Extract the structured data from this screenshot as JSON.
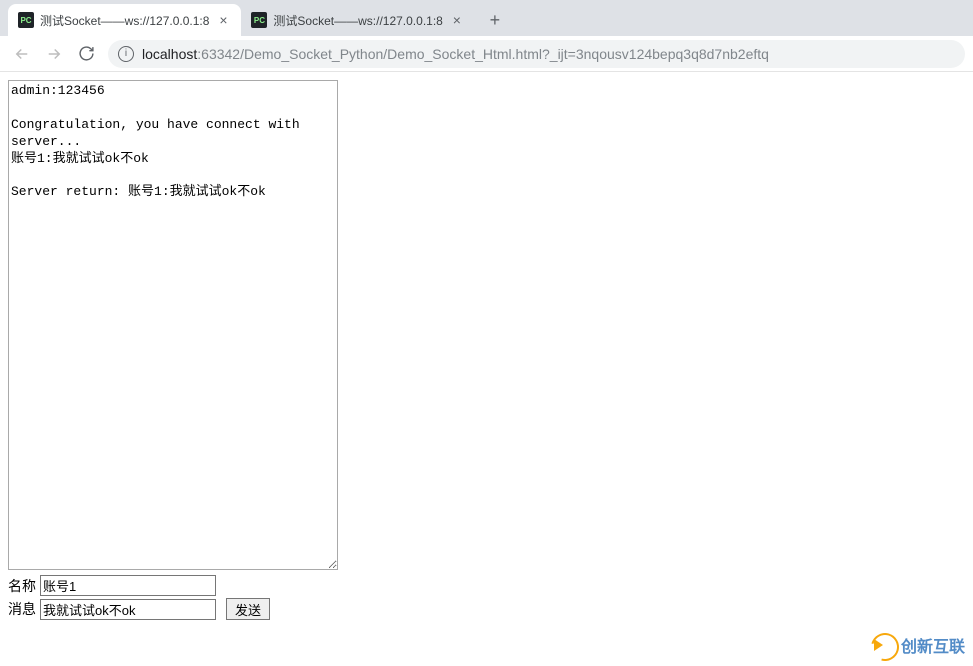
{
  "tabs": [
    {
      "favicon_label": "PC",
      "title": "测试Socket——ws://127.0.0.1:8"
    },
    {
      "favicon_label": "PC",
      "title": "测试Socket——ws://127.0.0.1:8"
    }
  ],
  "address": {
    "host": "localhost",
    "path": ":63342/Demo_Socket_Python/Demo_Socket_Html.html?_ijt=3nqousv124bepq3q8d7nb2eftq"
  },
  "log_text": "admin:123456\n\nCongratulation, you have connect with server...\n账号1:我就试试ok不ok\n\nServer return: 账号1:我就试试ok不ok",
  "form": {
    "name_label": "名称",
    "name_value": "账号1",
    "message_label": "消息",
    "message_value": "我就试试ok不ok",
    "send_label": "发送"
  },
  "watermark_text": "创新互联"
}
